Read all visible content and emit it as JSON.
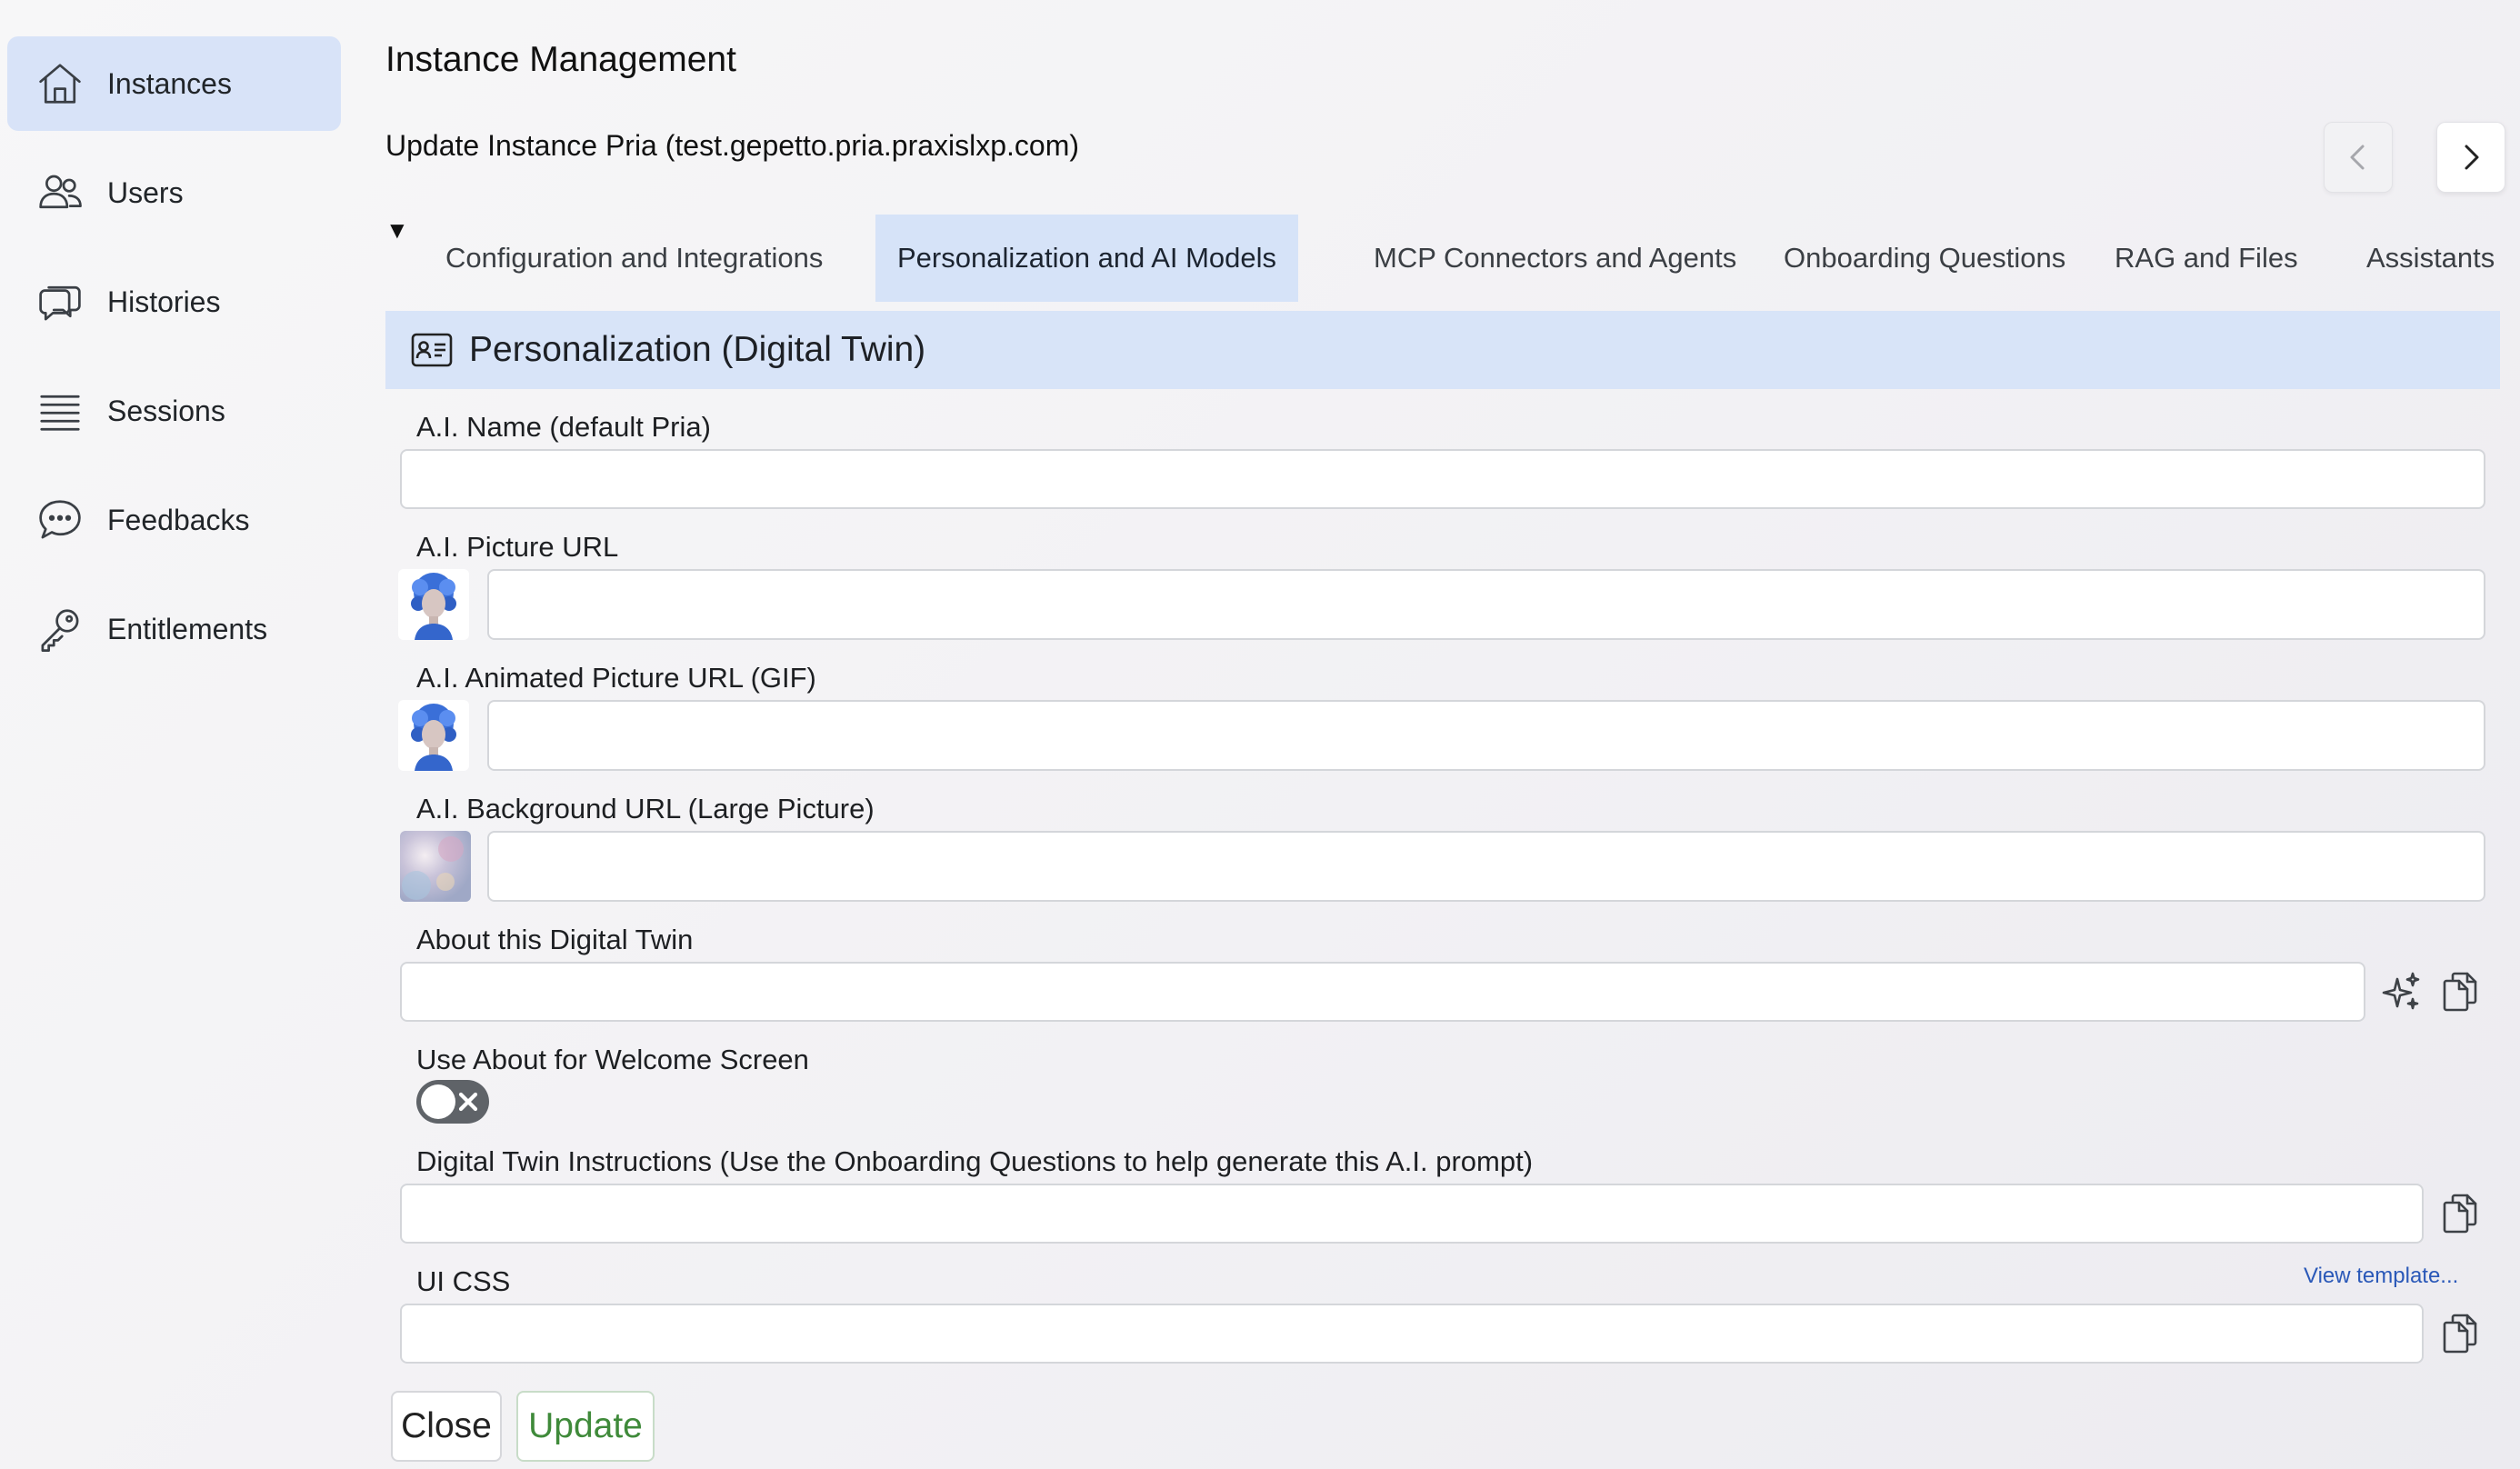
{
  "sidebar": {
    "items": [
      {
        "label": "Instances",
        "icon": "home-icon",
        "active": true
      },
      {
        "label": "Users",
        "icon": "users-icon"
      },
      {
        "label": "Histories",
        "icon": "chat-bubbles-icon"
      },
      {
        "label": "Sessions",
        "icon": "list-icon"
      },
      {
        "label": "Feedbacks",
        "icon": "chat-dots-icon"
      },
      {
        "label": "Entitlements",
        "icon": "key-icon"
      }
    ]
  },
  "header": {
    "title": "Instance Management",
    "subtitle": "Update Instance Pria (test.gepetto.pria.praxislxp.com)"
  },
  "collapse_toggle": "▼",
  "tabs": [
    {
      "label": "Configuration and Integrations"
    },
    {
      "label": "Personalization and AI Models",
      "active": true
    },
    {
      "label": "MCP Connectors and Agents"
    },
    {
      "label": "Onboarding Questions"
    },
    {
      "label": "RAG and Files"
    },
    {
      "label": "Assistants"
    }
  ],
  "section": {
    "title": "Personalization (Digital Twin)",
    "icon": "id-card-icon"
  },
  "fields": {
    "ai_name": {
      "label": "A.I. Name (default Pria)",
      "value": ""
    },
    "ai_picture": {
      "label": "A.I. Picture URL",
      "value": ""
    },
    "ai_animated": {
      "label": "A.I. Animated Picture URL (GIF)",
      "value": ""
    },
    "ai_background": {
      "label": "A.I. Background URL (Large Picture)",
      "value": ""
    },
    "about": {
      "label": "About this Digital Twin",
      "value": ""
    },
    "use_about": {
      "label": "Use About for Welcome Screen",
      "enabled": false
    },
    "instructions": {
      "label": "Digital Twin Instructions (Use the Onboarding Questions to help generate this A.I. prompt)",
      "value": ""
    },
    "ui_css": {
      "label": "UI CSS",
      "value": "",
      "link": "View template..."
    }
  },
  "footer": {
    "close_label": "Close",
    "update_label": "Update"
  },
  "colors": {
    "active_nav": "#d8e3f8",
    "section_header": "#d8e4f8",
    "update_text": "#3f8a3a",
    "link": "#2a58b8"
  }
}
